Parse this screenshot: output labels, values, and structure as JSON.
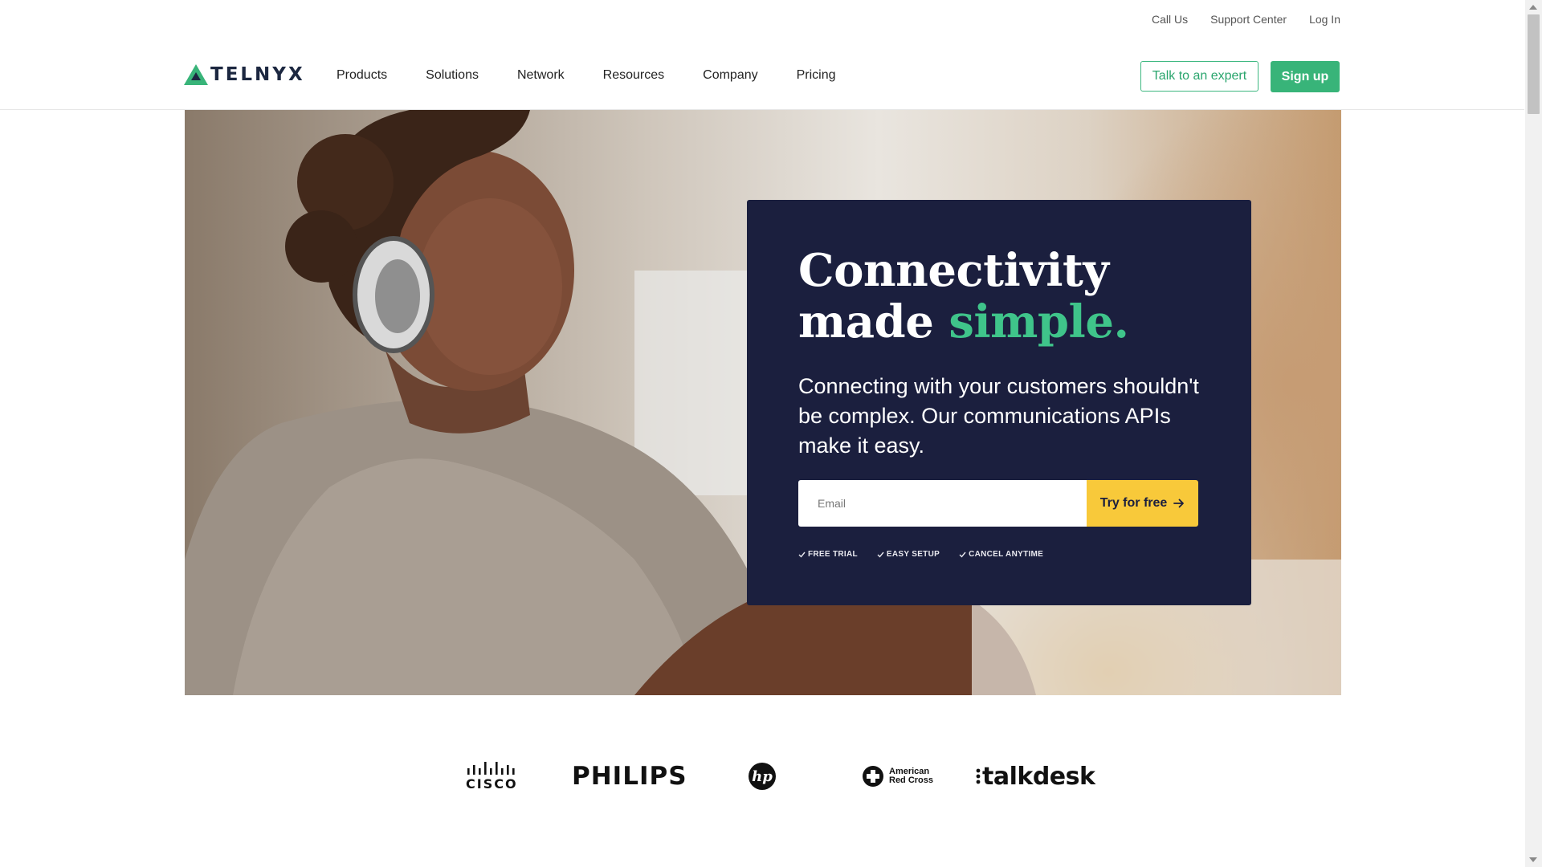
{
  "utility_nav": {
    "call_us": "Call Us",
    "support_center": "Support Center",
    "log_in": "Log In"
  },
  "header": {
    "logo_text": "TELNYX",
    "nav": [
      "Products",
      "Solutions",
      "Network",
      "Resources",
      "Company",
      "Pricing"
    ],
    "talk_to_expert": "Talk to an expert",
    "sign_up": "Sign up"
  },
  "hero": {
    "headline_line1": "Connectivity",
    "headline_line2_prefix": "made ",
    "headline_accent": "simple.",
    "subhead": "Connecting with your customers shouldn't be complex. Our communications APIs make it easy.",
    "email_placeholder": "Email",
    "cta_label": "Try for free",
    "perks": [
      "FREE TRIAL",
      "EASY SETUP",
      "CANCEL ANYTIME"
    ]
  },
  "customer_logos": {
    "cisco": "CISCO",
    "philips": "PHILIPS",
    "hp": "hp",
    "red_cross_line1": "American",
    "red_cross_line2": "Red Cross",
    "talkdesk": "talkdesk"
  },
  "colors": {
    "brand_green": "#38b479",
    "accent_green": "#3fc48a",
    "card_navy": "#1b1f3e",
    "cta_yellow": "#f8c93a",
    "logo_navy": "#1c2740"
  },
  "icons": {
    "logo_mark": "telnyx-triangle-logo",
    "arrow": "arrow-right-icon",
    "check": "check-icon",
    "red_cross": "red-cross-icon"
  }
}
